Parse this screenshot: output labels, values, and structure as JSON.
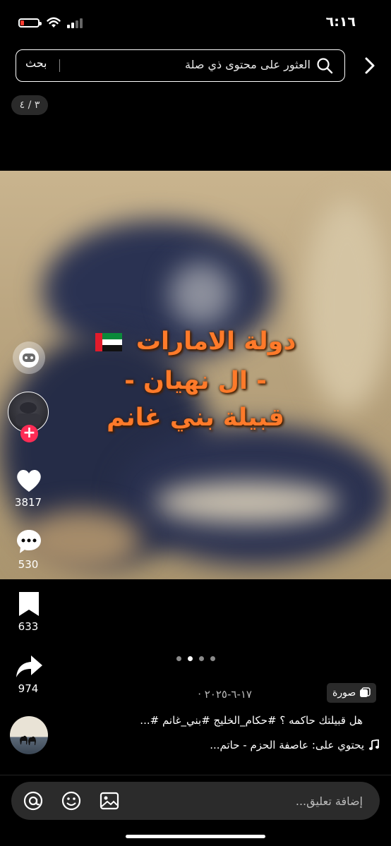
{
  "status_bar": {
    "time": "٦:١٦"
  },
  "search": {
    "placeholder": "العثور على محتوى ذي صلة",
    "button_label": "بحث"
  },
  "page_counter": "٣ / ٤",
  "image_overlay": {
    "line1": "دولة الامارات",
    "line2": "- ال نهيان -",
    "line3": "قبيلة بني غانم"
  },
  "actions": {
    "likes": "3817",
    "comments": "530",
    "saves": "633",
    "shares": "974"
  },
  "carousel": {
    "total": 4,
    "active_index": 1
  },
  "post": {
    "type_label": "صورة",
    "date": "١٧-٦-٢٠٢٥ ·",
    "caption": "هل قبيلتك حاكمه ؟ #حكام_الخليج #بني_غانم #...",
    "music": "يحتوي على: عاصفة الحزم - حاتم..."
  },
  "comment_bar": {
    "placeholder": "إضافة تعليق..."
  },
  "colors": {
    "accent_red": "#fe2c55",
    "overlay_text": "#ff7a2a",
    "background": "#000000"
  }
}
